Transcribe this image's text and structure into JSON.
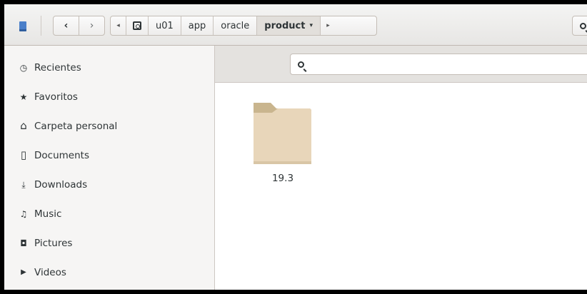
{
  "header": {
    "app_icon": "files-app-icon",
    "nav": {
      "back": "‹",
      "forward": "›"
    },
    "path": {
      "scroll_left": "◂",
      "drive_icon": "drive-icon",
      "crumbs": [
        "u01",
        "app",
        "oracle",
        "product"
      ],
      "active": "product",
      "active_caret": "▾",
      "scroll_right": "▸"
    },
    "search_icon": "search-icon"
  },
  "sidebar": {
    "items": [
      {
        "label": "Recientes",
        "icon": "clock-icon",
        "glyph": "◷"
      },
      {
        "label": "Favoritos",
        "icon": "star-icon",
        "glyph": "★"
      },
      {
        "label": "Carpeta personal",
        "icon": "home-icon",
        "glyph": "⌂"
      },
      {
        "label": "Documents",
        "icon": "document-icon",
        "glyph": "▯"
      },
      {
        "label": "Downloads",
        "icon": "download-icon",
        "glyph": "⤓"
      },
      {
        "label": "Music",
        "icon": "music-icon",
        "glyph": "♫"
      },
      {
        "label": "Pictures",
        "icon": "camera-icon",
        "glyph": "◘"
      },
      {
        "label": "Videos",
        "icon": "video-icon",
        "glyph": "▶"
      }
    ]
  },
  "search": {
    "placeholder": ""
  },
  "files": [
    {
      "name": "19.3",
      "icon": "folder-icon"
    }
  ],
  "colors": {
    "folder_front": "#e8d6ba",
    "folder_back": "#c9b58e",
    "headerbar": "#eeedec",
    "sidebar": "#f6f5f4"
  }
}
